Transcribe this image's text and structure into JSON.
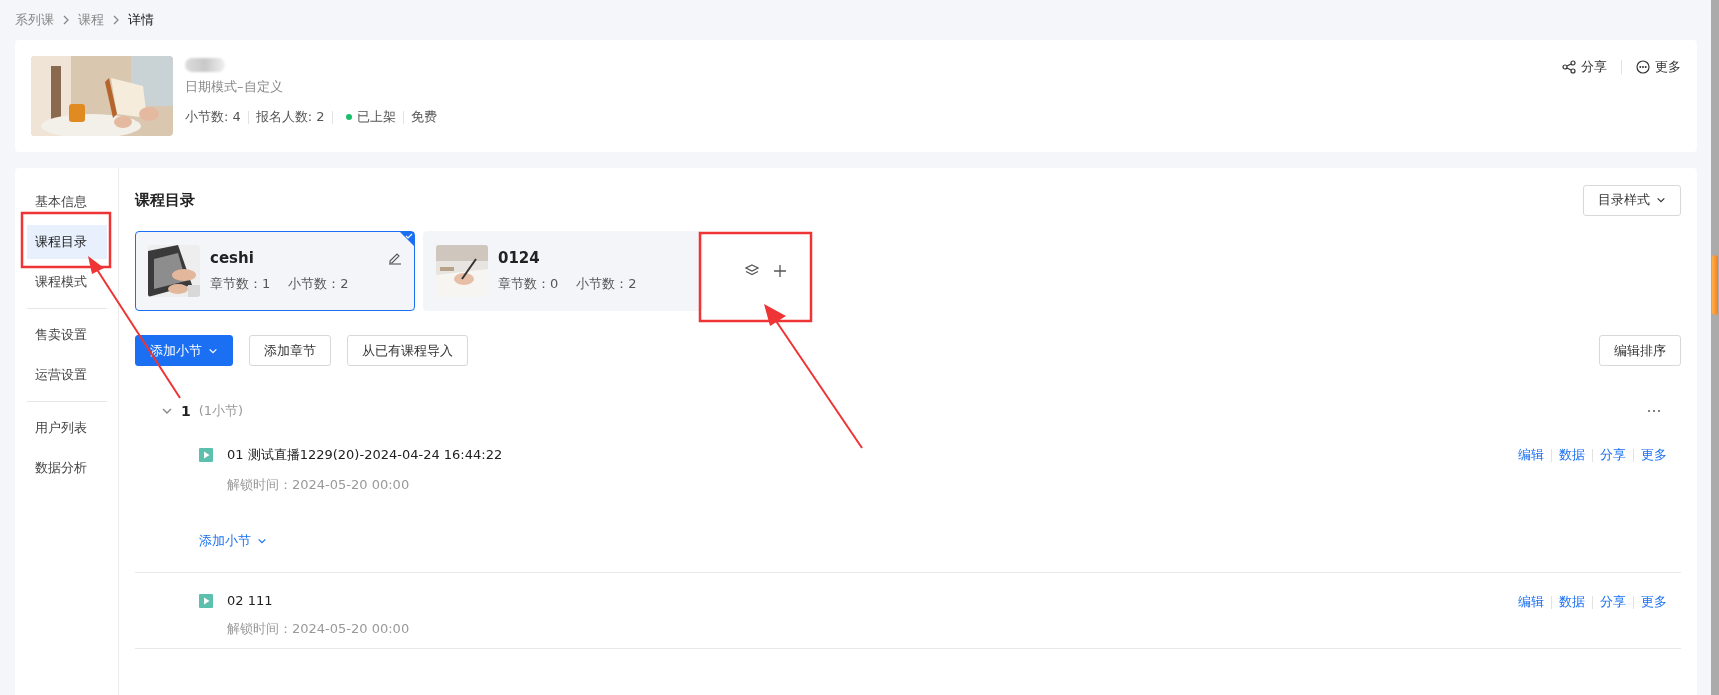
{
  "breadcrumb": [
    {
      "label": "系列课",
      "current": false
    },
    {
      "label": "课程",
      "current": false
    },
    {
      "label": "详情",
      "current": true
    }
  ],
  "course": {
    "subtitle": "日期模式–自定义",
    "stats": [
      "小节数: 4",
      "报名人数: 2"
    ],
    "status": {
      "label": "已上架",
      "color": "#19be6b"
    },
    "price": "免费"
  },
  "header_actions": [
    {
      "kind": "share",
      "label": "分享"
    },
    {
      "kind": "more",
      "label": "更多"
    }
  ],
  "sidebar": [
    [
      {
        "label": "基本信息",
        "selected": false
      },
      {
        "label": "课程目录",
        "selected": true
      },
      {
        "label": "课程模式",
        "selected": false
      }
    ],
    [
      {
        "label": "售卖设置",
        "selected": false
      },
      {
        "label": "运营设置",
        "selected": false
      }
    ],
    [
      {
        "label": "用户列表",
        "selected": false
      },
      {
        "label": "数据分析",
        "selected": false
      }
    ]
  ],
  "section_title": "课程目录",
  "style_dropdown": "目录样式",
  "directories": [
    {
      "name": "ceshi",
      "chapters": "章节数：1",
      "lessons": "小节数：2",
      "selected": true
    },
    {
      "name": "0124",
      "chapters": "章节数：0",
      "lessons": "小节数：2",
      "selected": false
    }
  ],
  "toolbar": [
    {
      "label": "添加小节",
      "kind": "primary"
    },
    {
      "label": "添加章节",
      "kind": "default"
    },
    {
      "label": "从已有课程导入",
      "kind": "default"
    }
  ],
  "sort_button": "编辑排序",
  "outline": [
    {
      "kind": "chapter",
      "number": "1",
      "count": "(1小节)",
      "expanded": true,
      "add_link": "添加小节",
      "children": [
        {
          "kind": "lesson",
          "title": "01 测试直播1229(20)-2024-04-24 16:44:22",
          "unlock": "解锁时间：2024-05-20 00:00",
          "actions": [
            "编辑",
            "数据",
            "分享",
            "更多"
          ]
        }
      ]
    },
    {
      "kind": "lesson",
      "title": "02 111",
      "unlock": "解锁时间：2024-05-20 00:00",
      "actions": [
        "编辑",
        "数据",
        "分享",
        "更多"
      ]
    }
  ]
}
